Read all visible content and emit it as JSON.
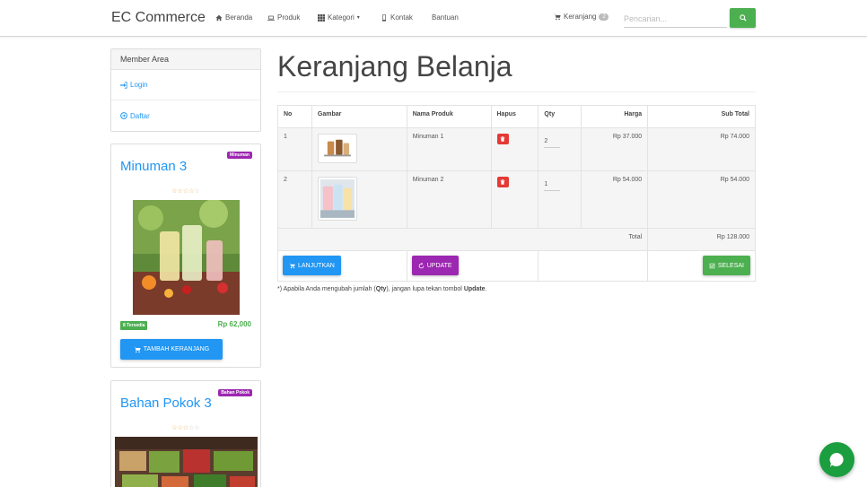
{
  "navbar": {
    "brand": "EC Commerce",
    "items": [
      {
        "label": "Beranda",
        "icon": "home-icon"
      },
      {
        "label": "Produk",
        "icon": "laptop-icon"
      },
      {
        "label": "Kategori",
        "icon": "grid-icon"
      },
      {
        "label": "Kontak",
        "icon": "phone-icon"
      },
      {
        "label": "Bantuan",
        "icon": ""
      }
    ],
    "cart_label": "Keranjang",
    "cart_count": "2",
    "search_placeholder": "Pencarian..."
  },
  "sidebar": {
    "member_title": "Member Area",
    "login_label": "Login",
    "register_label": "Daftar",
    "products": [
      {
        "title": "Minuman 3",
        "category": "Minuman",
        "rating": 4,
        "stock": "8 Tersedia",
        "price": "Rp 62,000",
        "button": "TAMBAH KERANJANG"
      },
      {
        "title": "Bahan Pokok 3",
        "category": "Bahan Pokok",
        "rating": 3
      }
    ]
  },
  "main": {
    "title": "Keranjang Belanja",
    "columns": [
      "No",
      "Gambar",
      "Nama Produk",
      "Hapus",
      "Qty",
      "Harga",
      "Sub Total"
    ],
    "rows": [
      {
        "no": "1",
        "name": "Minuman 1",
        "qty": "2",
        "price": "Rp 37.000",
        "subtotal": "Rp 74.000"
      },
      {
        "no": "2",
        "name": "Minuman 2",
        "qty": "1",
        "price": "Rp 54.000",
        "subtotal": "Rp 54.000"
      }
    ],
    "total_label": "Total",
    "total_value": "Rp 128.000",
    "continue_label": "LANJUTKAN",
    "update_label": "UPDATE",
    "finish_label": "SELESAI",
    "note_prefix": "*) Apabila Anda mengubah jumlah (",
    "note_qty": "Qty",
    "note_middle": "), jangan lupa tekan tombol ",
    "note_update": "Update",
    "note_suffix": "."
  },
  "colors": {
    "primary": "#2196f3",
    "success": "#4caf50",
    "purple": "#9c27b0",
    "danger": "#e53935",
    "chat": "#1a9e3f"
  }
}
